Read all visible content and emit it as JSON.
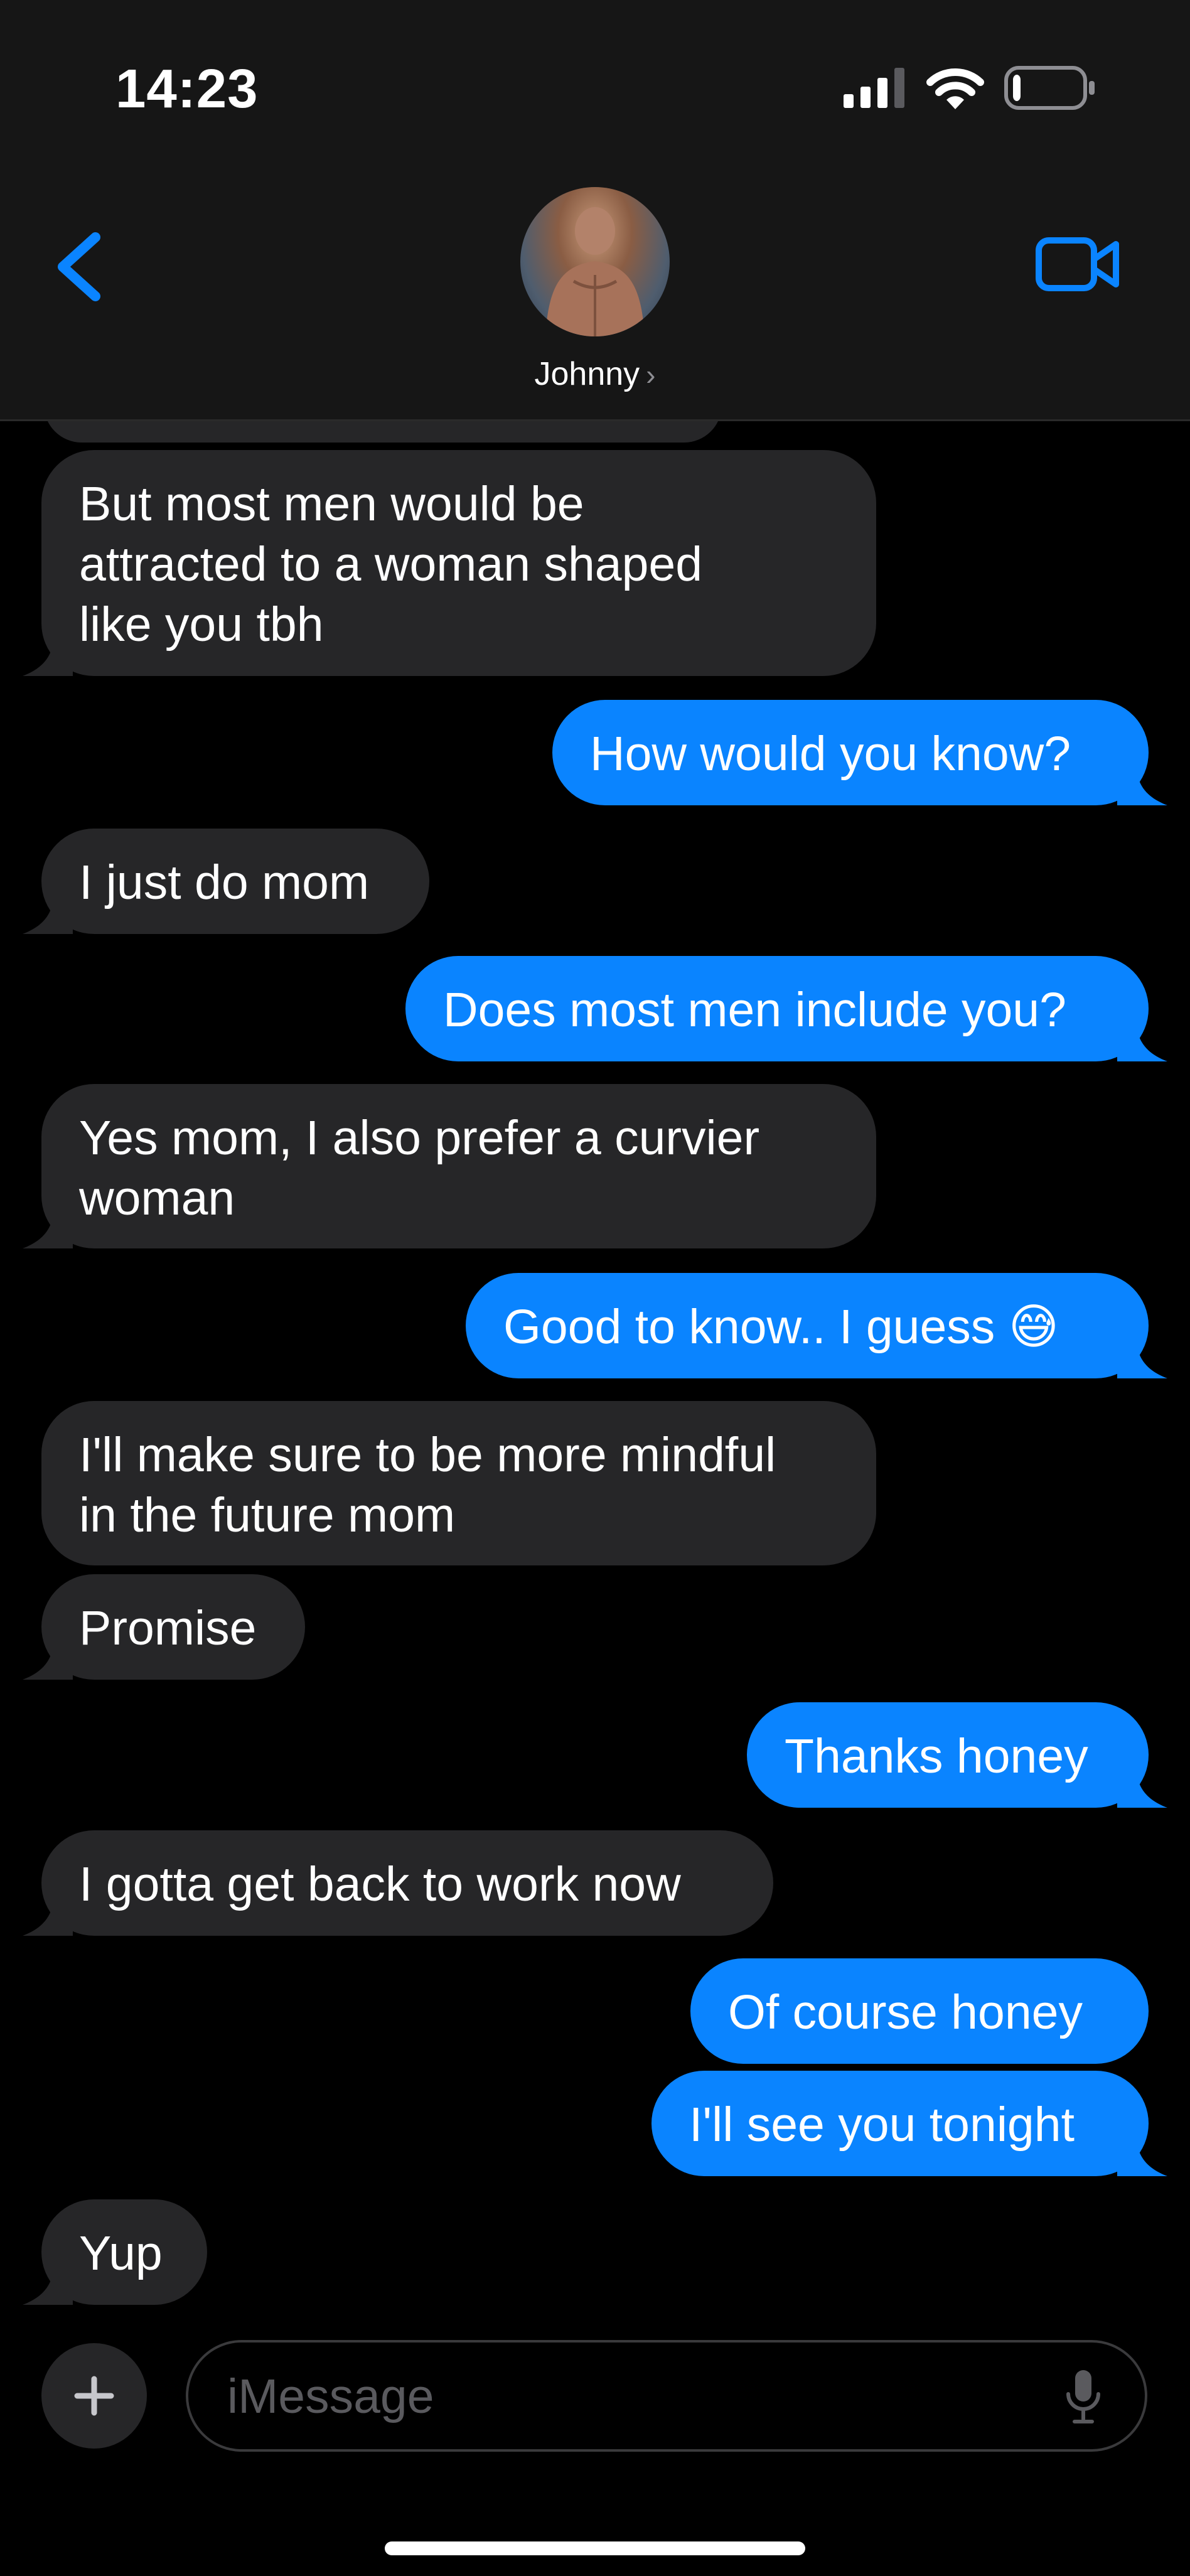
{
  "status_bar": {
    "time": "14:23",
    "battery_level": 0.12
  },
  "header": {
    "contact_name": "Johnny",
    "contact_chevron": "›"
  },
  "colors": {
    "accent": "#0a84ff",
    "incoming_bubble": "#262628",
    "background": "#000000"
  },
  "messages": [
    {
      "from": "them",
      "text": "But most men would be\nattracted to a woman shaped\nlike you tbh"
    },
    {
      "from": "me",
      "text": "How would you know?"
    },
    {
      "from": "them",
      "text": "I just do mom"
    },
    {
      "from": "me",
      "text": "Does most men include you?"
    },
    {
      "from": "them",
      "text": "Yes mom, I also prefer a curvier\nwoman"
    },
    {
      "from": "me",
      "text": "Good to know.. I guess 😅"
    },
    {
      "from": "them",
      "text": "I'll make sure to be more mindful\nin the future mom"
    },
    {
      "from": "them",
      "text": "Promise"
    },
    {
      "from": "me",
      "text": "Thanks honey"
    },
    {
      "from": "them",
      "text": "I gotta get back to work now"
    },
    {
      "from": "me",
      "text": "Of course honey"
    },
    {
      "from": "me",
      "text": "I'll see you tonight"
    },
    {
      "from": "them",
      "text": "Yup"
    }
  ],
  "composer": {
    "placeholder": "iMessage",
    "plus_icon": "plus-icon",
    "mic_icon": "microphone-icon"
  }
}
